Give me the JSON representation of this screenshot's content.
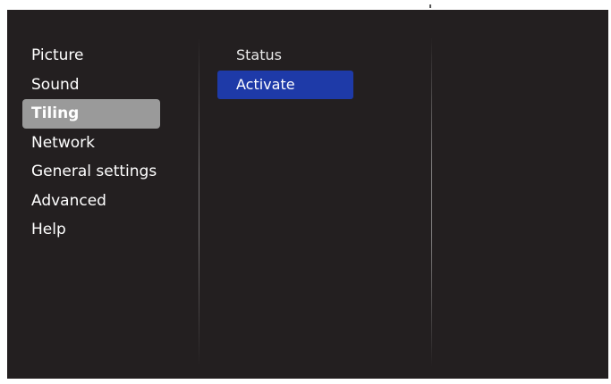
{
  "main_menu": {
    "items": [
      {
        "label": "Picture"
      },
      {
        "label": "Sound"
      },
      {
        "label": "Tiling"
      },
      {
        "label": "Network"
      },
      {
        "label": "General settings"
      },
      {
        "label": "Advanced"
      },
      {
        "label": "Help"
      }
    ],
    "selected_index": 2
  },
  "sub_menu": {
    "items": [
      {
        "label": "Status"
      },
      {
        "label": "Activate"
      }
    ],
    "active_index": 1
  },
  "colors": {
    "background": "#231f20",
    "selected_bg": "#9a9a9a",
    "active_bg": "#1e3aa8",
    "text": "#ffffff"
  }
}
